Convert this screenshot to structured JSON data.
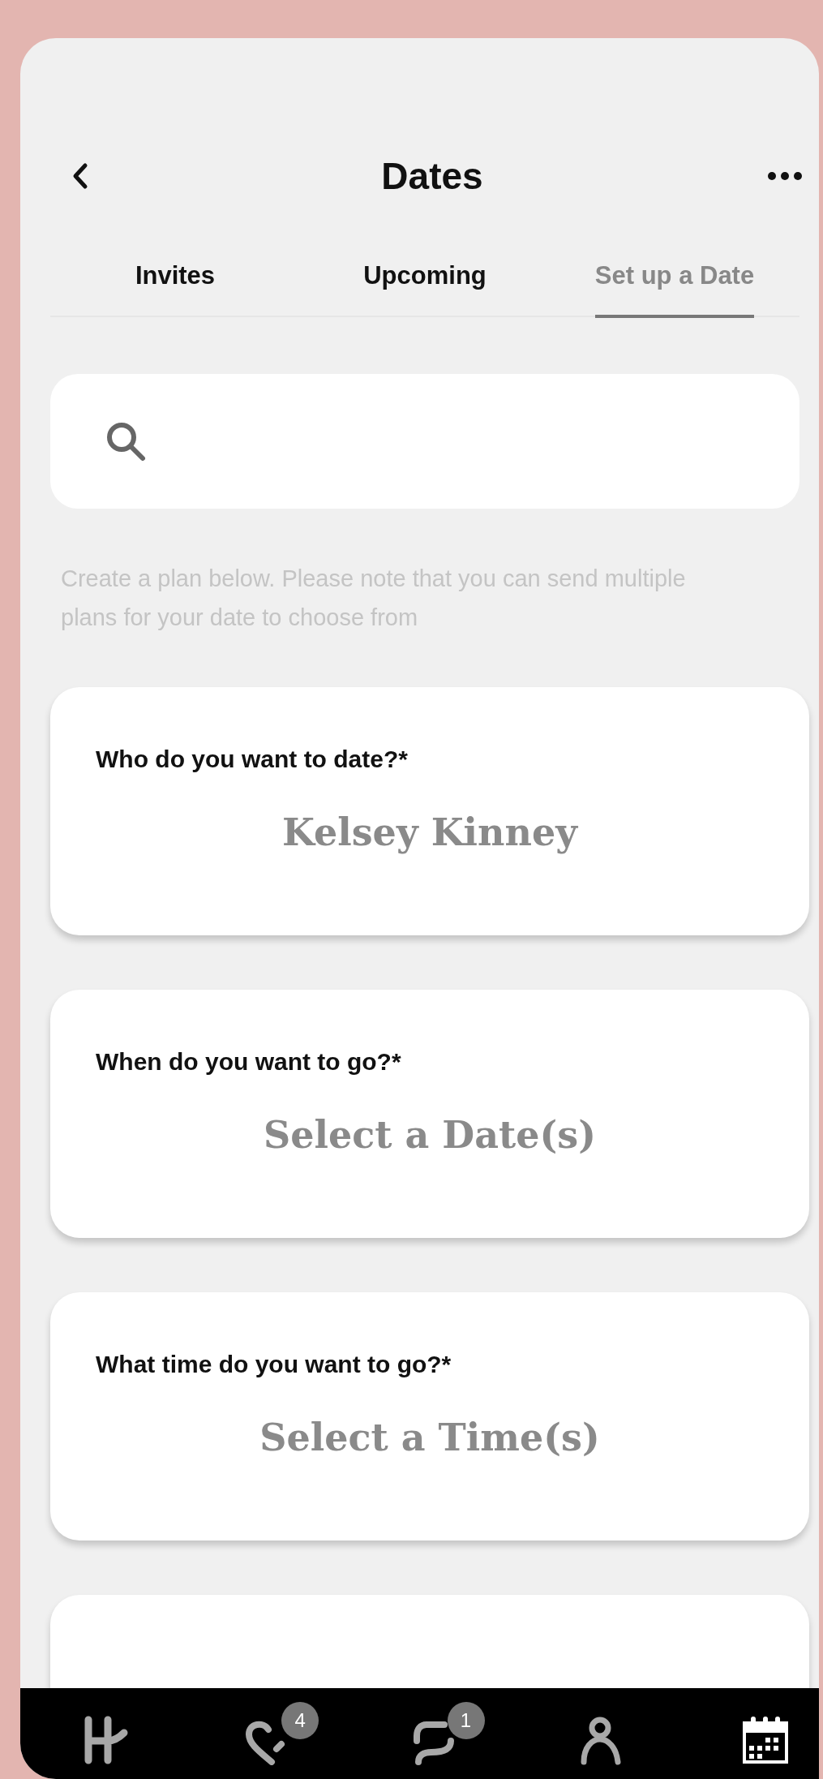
{
  "header": {
    "title": "Dates"
  },
  "tabs": [
    {
      "label": "Invites",
      "selected": false
    },
    {
      "label": "Upcoming",
      "selected": false
    },
    {
      "label": "Set up a Date",
      "selected": true
    }
  ],
  "instructions": "Create a plan below. Please note that you  can send multiple plans for your date to choose from",
  "cards": [
    {
      "question": "Who do you want to date?*",
      "answer": "Kelsey Kinney"
    },
    {
      "question": "When do you want to go?*",
      "answer": "Select a Date(s)"
    },
    {
      "question": "What time do you want to go?*",
      "answer": "Select a Time(s)"
    }
  ],
  "nav": [
    {
      "kind": "home",
      "selected": false
    },
    {
      "kind": "likes",
      "badge": "4",
      "selected": false
    },
    {
      "kind": "chat",
      "badge": "1",
      "selected": false
    },
    {
      "kind": "profile",
      "selected": false
    },
    {
      "kind": "calendar",
      "selected": true
    }
  ]
}
